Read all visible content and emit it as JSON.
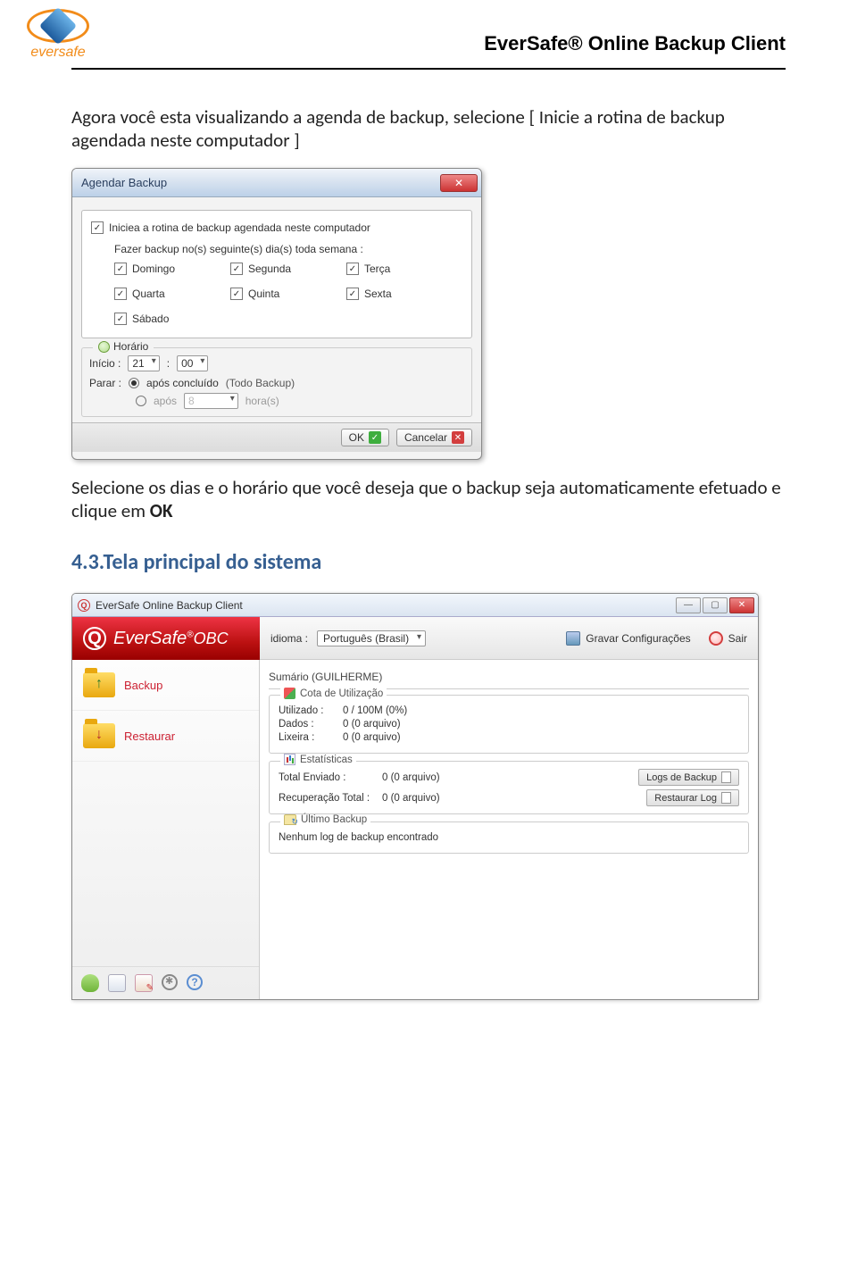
{
  "header": {
    "logo_text": "eversafe",
    "doc_title": "EverSafe® Online Backup Client"
  },
  "paras": {
    "p1": "Agora você esta visualizando a agenda de backup, selecione [ Inicie a rotina de backup agendada neste computador ]",
    "p2_pre": "Selecione os dias e o horário que você deseja que o backup seja automaticamente efetuado e clique em  ",
    "p2_bold": "OK"
  },
  "section_title": "4.3.Tela principal do sistema",
  "dialog1": {
    "title": "Agendar Backup",
    "enable_label": "Iniciea a rotina de backup agendada neste computador",
    "weekly_label": "Fazer backup no(s) seguinte(s) dia(s) toda semana :",
    "days": {
      "dom": "Domingo",
      "seg": "Segunda",
      "ter": "Terça",
      "qua": "Quarta",
      "qui": "Quinta",
      "sex": "Sexta",
      "sab": "Sábado"
    },
    "horario_legend": "Horário",
    "inicio_label": "Início :",
    "hour_val": "21",
    "min_val": "00",
    "parar_label": "Parar :",
    "parar_opt1_a": "após concluído",
    "parar_opt1_b": "(Todo Backup)",
    "apos_label": "após",
    "apos_val": "8",
    "apos_unit": "hora(s)",
    "ok": "OK",
    "cancel": "Cancelar"
  },
  "app": {
    "window_title": "EverSafe Online Backup Client",
    "brand_main": "EverSafe",
    "brand_sup": "®",
    "brand_sub": "OBC",
    "idioma_label": "idioma :",
    "idioma_value": "Português (Brasil)",
    "save_label": "Gravar Configurações",
    "exit_label": "Sair",
    "sidebar": {
      "backup": "Backup",
      "restore": "Restaurar"
    },
    "summary_label_pre": "Sumário (",
    "summary_user": "GUILHERME",
    "summary_label_post": ")",
    "quota": {
      "title": "Cota de Utilização",
      "utilizado_k": "Utilizado :",
      "utilizado_v": "0 / 100M (0%)",
      "dados_k": "Dados :",
      "dados_v": "0  (0 arquivo)",
      "lixeira_k": "Lixeira :",
      "lixeira_v": "0  (0 arquivo)"
    },
    "stats": {
      "title": "Estatísticas",
      "total_k": "Total Enviado :",
      "total_v": "0  (0 arquivo)",
      "recup_k": "Recuperação Total :",
      "recup_v": "0  (0 arquivo)",
      "logs_btn": "Logs de Backup",
      "rest_btn": "Restaurar Log"
    },
    "last": {
      "title": "Último Backup",
      "msg": "Nenhum log de backup encontrado"
    }
  }
}
